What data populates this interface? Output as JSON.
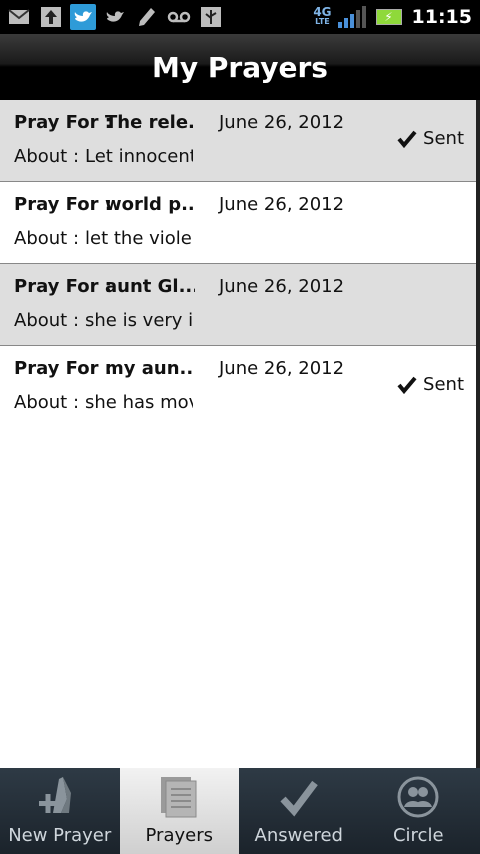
{
  "status_bar": {
    "network": "4G",
    "network_sub": "LTE",
    "time": "11:15",
    "icons": [
      "mail-icon",
      "upload-icon",
      "twitter-icon",
      "twitter-icon",
      "pencil-icon",
      "voicemail-icon",
      "usb-icon"
    ]
  },
  "header": {
    "title": "My Prayers"
  },
  "prayers": [
    {
      "pray_label": "Pray For :",
      "pray_value": "The rele...",
      "date": "June 26, 2012",
      "about_label": "About :",
      "about_value": "Let innocent (",
      "status": "Sent"
    },
    {
      "pray_label": "Pray For :",
      "pray_value": "world p...",
      "date": "June 26, 2012",
      "about_label": "About :",
      "about_value": "let the violenc",
      "status": ""
    },
    {
      "pray_label": "Pray For :",
      "pray_value": "aunt Gl...",
      "date": "June 26, 2012",
      "about_label": "About :",
      "about_value": "she is very ill \\",
      "status": ""
    },
    {
      "pray_label": "Pray For :",
      "pray_value": "my aun...",
      "date": "June 26, 2012",
      "about_label": "About :",
      "about_value": "she has move",
      "status": "Sent"
    }
  ],
  "tabs": [
    {
      "label": "New Prayer",
      "icon": "praying-hands-plus-icon",
      "active": false
    },
    {
      "label": "Prayers",
      "icon": "document-stack-icon",
      "active": true
    },
    {
      "label": "Answered",
      "icon": "checkmark-icon",
      "active": false
    },
    {
      "label": "Circle",
      "icon": "people-circle-icon",
      "active": false
    }
  ],
  "colors": {
    "shaded_row": "#dedede",
    "twitter_highlight": "#2e9bd8",
    "battery": "#8fd93a",
    "signal": "#4a90d9"
  }
}
